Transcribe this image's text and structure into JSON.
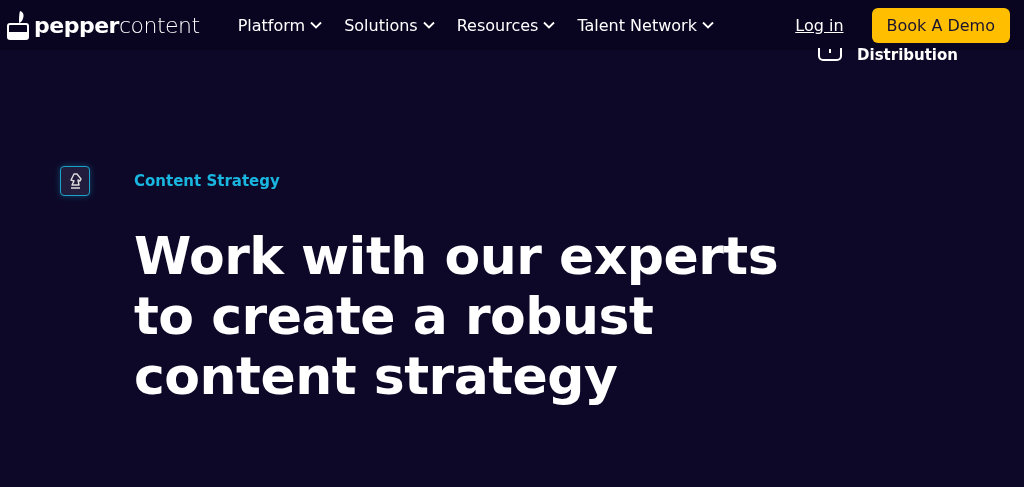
{
  "header": {
    "logo": "**pepper**content",
    "nav": [
      {
        "label": "Platform"
      },
      {
        "label": "Solutions"
      },
      {
        "label": "Resources"
      },
      {
        "label": "Talent Network"
      }
    ],
    "login": "Log in",
    "cta": "Book A Demo"
  },
  "dropdown_item": {
    "label": "Distribution"
  },
  "hero": {
    "tag": "Content Strategy",
    "heading": "Work with our experts to create a robust content strategy"
  }
}
